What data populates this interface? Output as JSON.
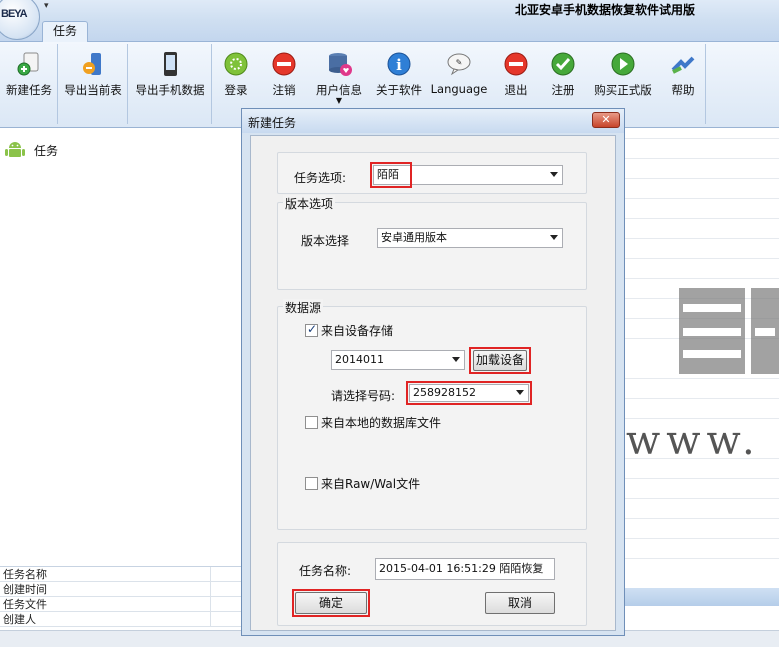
{
  "app": {
    "title": "北亚安卓手机数据恢复软件试用版",
    "logo_text": "BEYA",
    "qat_glyph": "▾"
  },
  "tabs": [
    {
      "label": "任务"
    }
  ],
  "toolbar": {
    "buttons": [
      {
        "label": "新建任务",
        "icon": "new-task-icon"
      },
      {
        "label": "导出当前表",
        "icon": "export-table-icon"
      },
      {
        "label": "导出手机数据",
        "icon": "export-phone-icon"
      },
      {
        "label": "登录",
        "icon": "login-icon"
      },
      {
        "label": "注销",
        "icon": "logout-icon"
      },
      {
        "label": "用户信息",
        "icon": "user-info-icon"
      },
      {
        "label": "关于软件",
        "icon": "about-icon"
      },
      {
        "label": "Language",
        "icon": "language-icon"
      },
      {
        "label": "退出",
        "icon": "exit-icon"
      },
      {
        "label": "注册",
        "icon": "register-icon"
      },
      {
        "label": "购买正式版",
        "icon": "buy-icon"
      },
      {
        "label": "帮助",
        "icon": "help-icon"
      }
    ]
  },
  "tree": {
    "items": [
      {
        "label": "任务",
        "icon": "android-icon"
      }
    ]
  },
  "info_table": {
    "rows": [
      "任务名称",
      "创建时间",
      "任务文件",
      "创建人"
    ]
  },
  "watermark": {
    "text": "www. f"
  },
  "dialog": {
    "title": "新建任务",
    "close_glyph": "✕",
    "task_option": {
      "label": "任务选项:",
      "value": "陌陌"
    },
    "version_group": {
      "legend": "版本选项",
      "label": "版本选择",
      "value": "安卓通用版本"
    },
    "source_group": {
      "legend": "数据源",
      "from_device": {
        "label": "来自设备存储",
        "checked": true
      },
      "device_value": "2014011",
      "load_button": "加载设备",
      "number_label": "请选择号码:",
      "number_value": "258928152",
      "from_local_db": {
        "label": "来自本地的数据库文件",
        "checked": false
      },
      "from_raw": {
        "label": "来自Raw/Wal文件",
        "checked": false
      }
    },
    "task_name": {
      "label": "任务名称:",
      "value": "2015-04-01 16:51:29 陌陌恢复"
    },
    "ok_button": "确定",
    "cancel_button": "取消"
  },
  "colors": {
    "highlight": "#e02424",
    "ribbon": "#dbe7f5",
    "dialog_frame": "#d6e3f1"
  }
}
